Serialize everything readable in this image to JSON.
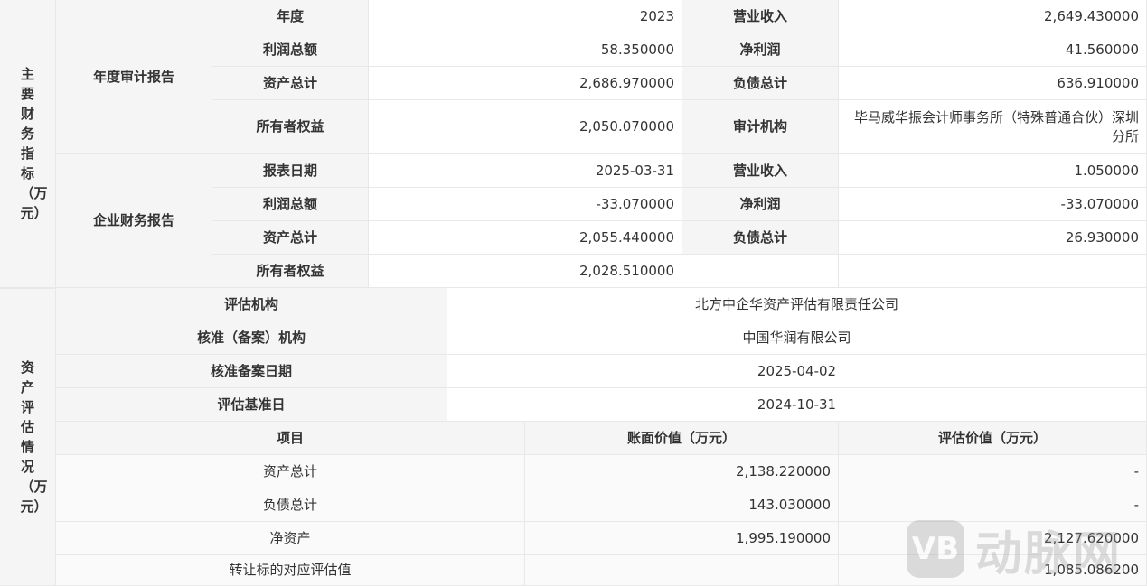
{
  "fin": {
    "section_label": "主要财务指标（万元）",
    "audit": {
      "label": "年度审计报告",
      "year_label": "年度",
      "year": "2023",
      "revenue_label": "营业收入",
      "revenue": "2,649.430000",
      "total_profit_label": "利润总额",
      "total_profit": "58.350000",
      "net_profit_label": "净利润",
      "net_profit": "41.560000",
      "total_assets_label": "资产总计",
      "total_assets": "2,686.970000",
      "total_liab_label": "负债总计",
      "total_liab": "636.910000",
      "equity_label": "所有者权益",
      "equity": "2,050.070000",
      "auditor_label": "审计机构",
      "auditor": "毕马威华振会计师事务所（特殊普通合伙）深圳分所"
    },
    "report": {
      "label": "企业财务报告",
      "date_label": "报表日期",
      "date": "2025-03-31",
      "revenue_label": "营业收入",
      "revenue": "1.050000",
      "total_profit_label": "利润总额",
      "total_profit": "-33.070000",
      "net_profit_label": "净利润",
      "net_profit": "-33.070000",
      "total_assets_label": "资产总计",
      "total_assets": "2,055.440000",
      "total_liab_label": "负债总计",
      "total_liab": "26.930000",
      "equity_label": "所有者权益",
      "equity": "2,028.510000"
    }
  },
  "eval": {
    "section_label": "资产评估情况（万元）",
    "org_label": "评估机构",
    "org": "北方中企华资产评估有限责任公司",
    "approve_org_label": "核准（备案）机构",
    "approve_org": "中国华润有限公司",
    "approve_date_label": "核准备案日期",
    "approve_date": "2025-04-02",
    "base_date_label": "评估基准日",
    "base_date": "2024-10-31",
    "columns": [
      "项目",
      "账面价值（万元）",
      "评估价值（万元）"
    ],
    "rows": [
      {
        "item": "资产总计",
        "book": "2,138.220000",
        "eval": "-"
      },
      {
        "item": "负债总计",
        "book": "143.030000",
        "eval": "-"
      },
      {
        "item": "净资产",
        "book": "1,995.190000",
        "eval": "2,127.620000"
      },
      {
        "item": "转让标的对应评估值",
        "book": "",
        "eval": "1,085.086200"
      }
    ]
  },
  "watermark": {
    "logo_text": "VB",
    "text": "动脉网",
    "icon": "vb-logo-icon"
  }
}
